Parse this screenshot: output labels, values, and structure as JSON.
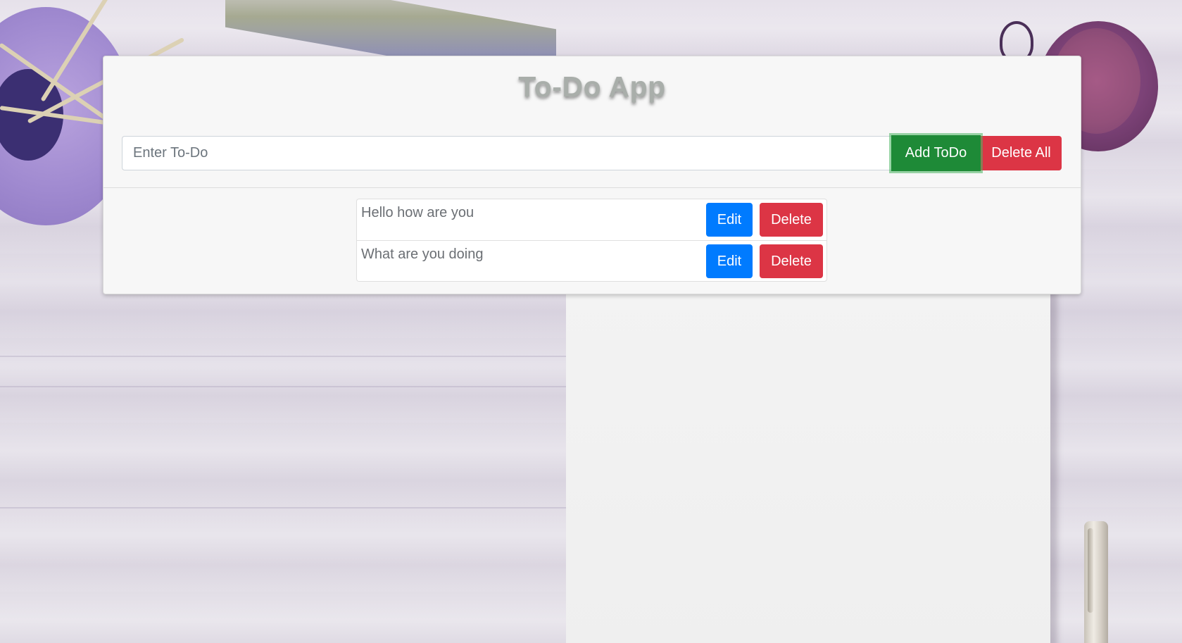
{
  "app": {
    "title": "To-Do App"
  },
  "form": {
    "input_placeholder": "Enter To-Do",
    "input_value": "",
    "add_label": "Add ToDo",
    "delete_all_label": "Delete All"
  },
  "todos": [
    {
      "text": "Hello how are you",
      "edit_label": "Edit",
      "delete_label": "Delete"
    },
    {
      "text": "What are you doing",
      "edit_label": "Edit",
      "delete_label": "Delete"
    }
  ],
  "colors": {
    "add": "#1e8a37",
    "danger": "#dc3545",
    "primary": "#007bff",
    "card": "#f7f7f7",
    "title": "#a9aeaa"
  },
  "icons": {
    "background": "desk-scene-image"
  }
}
